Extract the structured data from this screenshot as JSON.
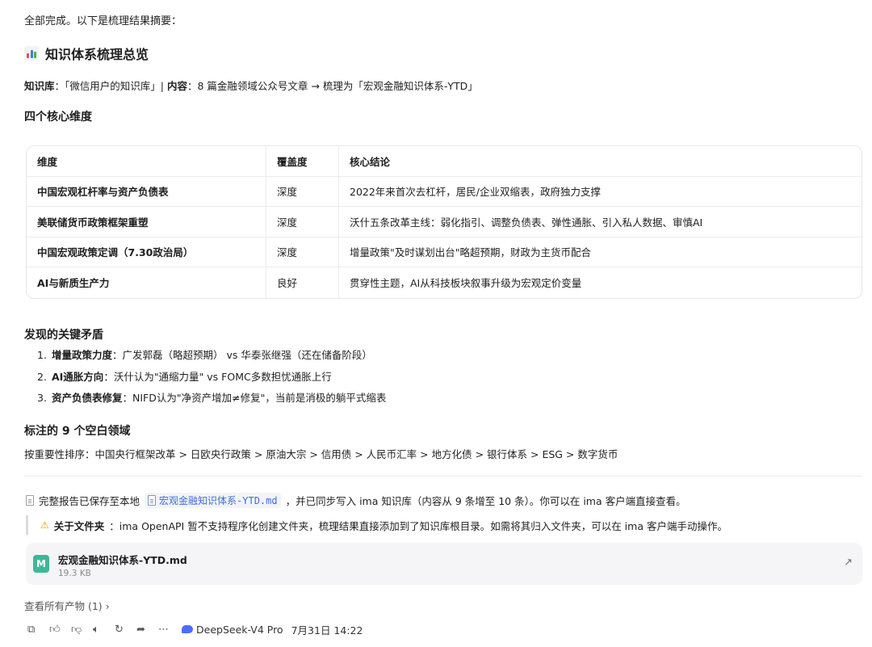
{
  "intro": "全部完成。以下是梳理结果摘要：",
  "heading": "知识体系梳理总览",
  "kb": {
    "label1": "知识库",
    "value1": "：「微信用户的知识库」| ",
    "label2": "内容",
    "value2": "：8 篇金融领域公众号文章 → 梳理为「宏观金融知识体系-YTD」"
  },
  "dims_title": "四个核心维度",
  "table": {
    "headers": [
      "维度",
      "覆盖度",
      "核心结论"
    ],
    "rows": [
      [
        "中国宏观杠杆率与资产负债表",
        "深度",
        "2022年来首次去杠杆，居民/企业双缩表，政府独力支撑"
      ],
      [
        "美联储货币政策框架重塑",
        "深度",
        "沃什五条改革主线：弱化指引、调整负债表、弹性通胀、引入私人数据、审慎AI"
      ],
      [
        "中国宏观政策定调（7.30政治局）",
        "深度",
        "增量政策\"及时谋划出台\"略超预期，财政为主货币配合"
      ],
      [
        "AI与新质生产力",
        "良好",
        "贯穿性主题，AI从科技板块叙事升级为宏观定价变量"
      ]
    ]
  },
  "contradictions_title": "发现的关键矛盾",
  "contradictions": [
    {
      "num": "1.",
      "label": "增量政策力度",
      "text": "：广发郭磊（略超预期） vs 华泰张继强（还在储备阶段）"
    },
    {
      "num": "2.",
      "label": "AI通胀方向",
      "text": "：沃什认为\"通缩力量\" vs FOMC多数担忧通胀上行"
    },
    {
      "num": "3.",
      "label": "资产负债表修复",
      "text": "：NIFD认为\"净资产增加≠修复\"，当前是消极的躺平式缩表"
    }
  ],
  "gaps_title": "标注的 9 个空白领域",
  "gaps_rank": "按重要性排序：中国央行框架改革 > 日欧央行政策 > 原油大宗 > 信用债 > 人民币汇率 > 地方化债 > 银行体系 > ESG > 数字货币",
  "saved": {
    "prefix": "完整报告已保存至本地",
    "file": "宏观金融知识体系-YTD.md",
    "suffix": "，并已同步写入 ima 知识库（内容从 9 条增至 10 条）。你可以在 ima 客户端直接查看。"
  },
  "note": {
    "label": "关于文件夹",
    "text": "：ima OpenAPI 暂不支持程序化创建文件夹，梳理结果直接添加到了知识库根目录。如需将其归入文件夹，可以在 ima 客户端手动操作。"
  },
  "file_card": {
    "name": "宏观金融知识体系-YTD.md",
    "size": "19.3 KB",
    "icon": "M"
  },
  "view_all": "查看所有产物 (1)",
  "footer": {
    "model": "DeepSeek-V4 Pro",
    "date": "7月31日 14:22",
    "icons": [
      "copy-icon",
      "thumbs-up-icon",
      "thumbs-down-icon",
      "speaker-icon",
      "refresh-icon",
      "share-icon",
      "more-icon"
    ]
  },
  "colors": {
    "link": "#3f6fd8",
    "md_icon": "#3bb89a",
    "warn": "#e0a100",
    "model_logo": "#4d6bfe"
  }
}
